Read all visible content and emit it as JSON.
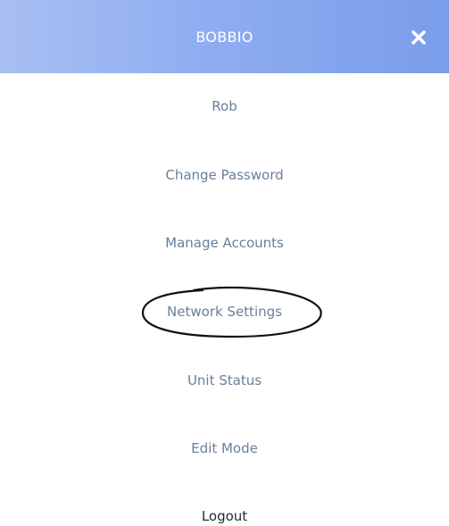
{
  "header": {
    "title": "BOBBIO",
    "close_icon": "close-icon",
    "background_colors": [
      "#a8bff2",
      "#7a9de9"
    ]
  },
  "menu": {
    "items": [
      {
        "label": "Rob"
      },
      {
        "label": "Change Password"
      },
      {
        "label": "Manage Accounts"
      },
      {
        "label": "Network Settings"
      },
      {
        "label": "Unit Status"
      },
      {
        "label": "Edit Mode"
      },
      {
        "label": "Logout"
      }
    ],
    "item_color": "#6a7f9a",
    "logout_color": "#1f2a36"
  },
  "annotation": {
    "type": "hand-drawn-ellipse",
    "target": "Network Settings"
  }
}
